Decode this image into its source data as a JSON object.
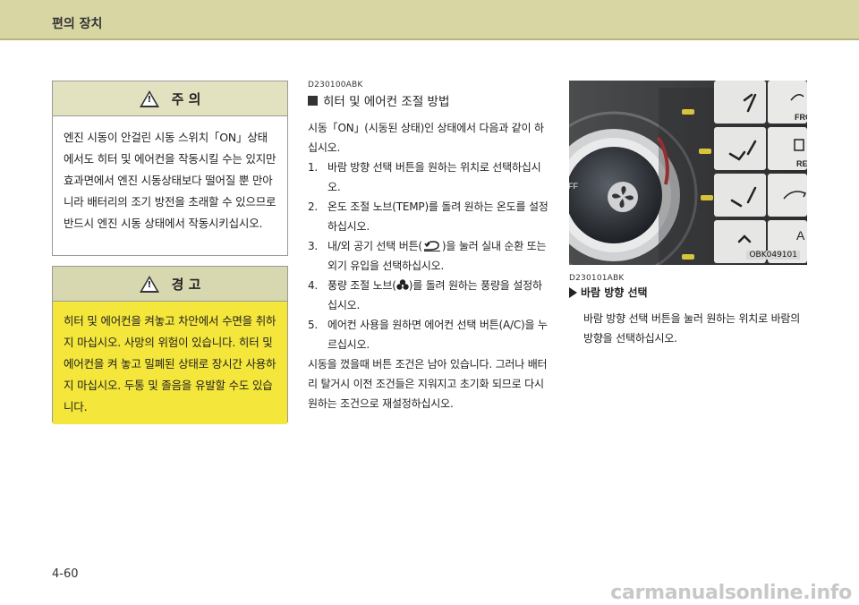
{
  "header": {
    "title": "편의 장치"
  },
  "caution": {
    "title": "주 의",
    "body": "엔진 시동이 안걸린 시동 스위치「ON」상태에서도 히터 및 에어컨을 작동시킬 수는 있지만 효과면에서 엔진 시동상태보다 떨어질 뿐 만아니라 배터리의 조기 방전을 초래할 수 있으므로 반드시 엔진 시동 상태에서 작동시키십시오."
  },
  "warning": {
    "title": "경 고",
    "body": "히터 및 에어컨을 켜놓고 차안에서 수면을 취하지 마십시오. 사망의 위험이 있습니다. 히터 및 에어컨을 켜 놓고 밀폐된 상태로 장시간 사용하지 마십시오. 두통 및 졸음을 유발할 수도 있습니다."
  },
  "section": {
    "code": "D230100ABK",
    "title": "히터 및 에어컨 조절 방법",
    "intro": "시동「ON」(시동된 상태)인 상태에서 다음과 같이 하십시오.",
    "steps": [
      {
        "num": "1.",
        "text": "바람 방향 선택 버튼을 원하는 위치로 선택하십시오."
      },
      {
        "num": "2.",
        "text": "온도 조절 노브(TEMP)를 돌려 원하는 온도를 설정하십시오."
      },
      {
        "num": "3.",
        "pre": "내/외 공기 선택 버튼(",
        "post": ")을 눌러 실내 순환 또는 외기 유입을 선택하십시오."
      },
      {
        "num": "4.",
        "pre": "풍량 조절 노브(",
        "post": ")를 돌려 원하는 풍량을 설정하십시오."
      },
      {
        "num": "5.",
        "text": "에어컨 사용을 원하면 에어컨 선택 버튼(A/C)을 누르십시오."
      }
    ],
    "outro": "시동을 껐을때 버튼 조건은 남아 있습니다. 그러나 배터리 탈거시 이전 조건들은 지워지고 초기화 되므로 다시 원하는 조건으로 재설정하십시오."
  },
  "figure": {
    "caption": "OBK049101",
    "labels": [
      "FRO",
      "RE",
      "A"
    ]
  },
  "subsection": {
    "code": "D230101ABK",
    "title": "바람 방향 선택",
    "body": "바람 방향 선택 버튼을 눌러 원하는 위치로 바람의 방향을 선택하십시오."
  },
  "page": {
    "number": "4-60"
  },
  "watermark": "carmanualsonline.info"
}
